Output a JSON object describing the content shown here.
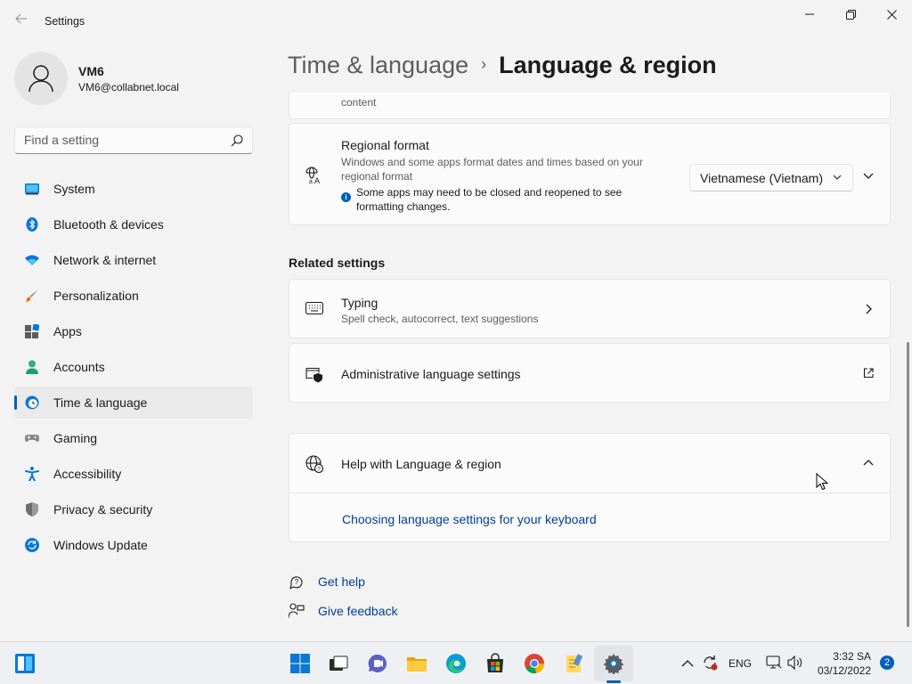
{
  "window": {
    "title": "Settings",
    "back_icon": "back-arrow-icon",
    "controls": [
      "minimize-icon",
      "restore-icon",
      "close-icon"
    ]
  },
  "user": {
    "name": "VM6",
    "email": "VM6@collabnet.local"
  },
  "search": {
    "placeholder": "Find a setting"
  },
  "sidebar": {
    "items": [
      {
        "label": "System",
        "icon": "system-icon"
      },
      {
        "label": "Bluetooth & devices",
        "icon": "bluetooth-icon"
      },
      {
        "label": "Network & internet",
        "icon": "wifi-icon"
      },
      {
        "label": "Personalization",
        "icon": "brush-icon"
      },
      {
        "label": "Apps",
        "icon": "apps-icon"
      },
      {
        "label": "Accounts",
        "icon": "accounts-icon"
      },
      {
        "label": "Time & language",
        "icon": "globe-clock-icon",
        "selected": true
      },
      {
        "label": "Gaming",
        "icon": "gamepad-icon"
      },
      {
        "label": "Accessibility",
        "icon": "accessibility-icon"
      },
      {
        "label": "Privacy & security",
        "icon": "shield-icon"
      },
      {
        "label": "Windows Update",
        "icon": "update-icon"
      }
    ]
  },
  "header": {
    "parent": "Time & language",
    "separator": "›",
    "current": "Language & region"
  },
  "main": {
    "partial_card": {
      "desc": "content"
    },
    "regional_format": {
      "title": "Regional format",
      "desc": "Windows and some apps format dates and times based on your regional format",
      "info": "Some apps may need to be closed and reopened to see formatting changes.",
      "value": "Vietnamese (Vietnam)"
    },
    "related_title": "Related settings",
    "typing": {
      "title": "Typing",
      "desc": "Spell check, autocorrect, text suggestions"
    },
    "admin": {
      "title": "Administrative language settings"
    },
    "help": {
      "title": "Help with Language & region",
      "link": "Choosing language settings for your keyboard"
    },
    "get_help": "Get help",
    "give_feedback": "Give feedback"
  },
  "taskbar": {
    "apps": [
      "start-icon",
      "task-view-icon",
      "chat-icon",
      "file-explorer-icon",
      "edge-icon",
      "store-icon",
      "chrome-icon",
      "notepad-icon",
      "settings-icon"
    ],
    "lang": "ENG",
    "time": "3:32 SA",
    "date": "03/12/2022",
    "notifications": "2"
  },
  "colors": {
    "accent": "#005fb8",
    "link": "#003e92",
    "background": "#f3f3f3",
    "card": "#fbfbfb"
  }
}
